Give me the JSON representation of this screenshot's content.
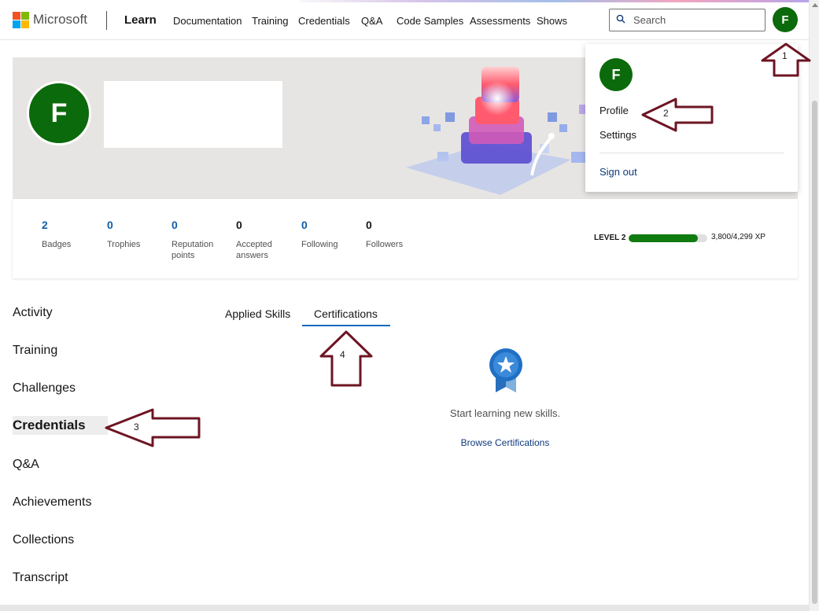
{
  "brand": "Microsoft",
  "section": "Learn",
  "nav": [
    "Documentation",
    "Training",
    "Credentials",
    "Q&A",
    "Code Samples",
    "Assessments",
    "Shows"
  ],
  "search": {
    "placeholder": "Search"
  },
  "user": {
    "initial": "F"
  },
  "stats": [
    {
      "value": "2",
      "label": "Badges",
      "color": "#0f5ea8"
    },
    {
      "value": "0",
      "label": "Trophies",
      "color": "#0f5ea8"
    },
    {
      "value": "0",
      "label": "Reputation points",
      "color": "#0f5ea8"
    },
    {
      "value": "0",
      "label": "Accepted answers",
      "color": "#161616"
    },
    {
      "value": "0",
      "label": "Following",
      "color": "#0f5ea8"
    },
    {
      "value": "0",
      "label": "Followers",
      "color": "#161616"
    }
  ],
  "level": {
    "label": "LEVEL 2",
    "xp": "3,800/4,299 XP",
    "progress": 0.884
  },
  "sidebar": [
    "Activity",
    "Training",
    "Challenges",
    "Credentials",
    "Q&A",
    "Achievements",
    "Collections",
    "Transcript"
  ],
  "tabs": [
    "Applied Skills",
    "Certifications"
  ],
  "empty": {
    "message": "Start learning new skills.",
    "link": "Browse Certifications"
  },
  "menu": {
    "profile": "Profile",
    "settings": "Settings",
    "signout": "Sign out"
  },
  "annotations": [
    "1",
    "2",
    "3",
    "4"
  ],
  "colors": {
    "accent": "#0f6cbd",
    "avatar": "#0b6a0b",
    "annotation": "#6e1423"
  }
}
